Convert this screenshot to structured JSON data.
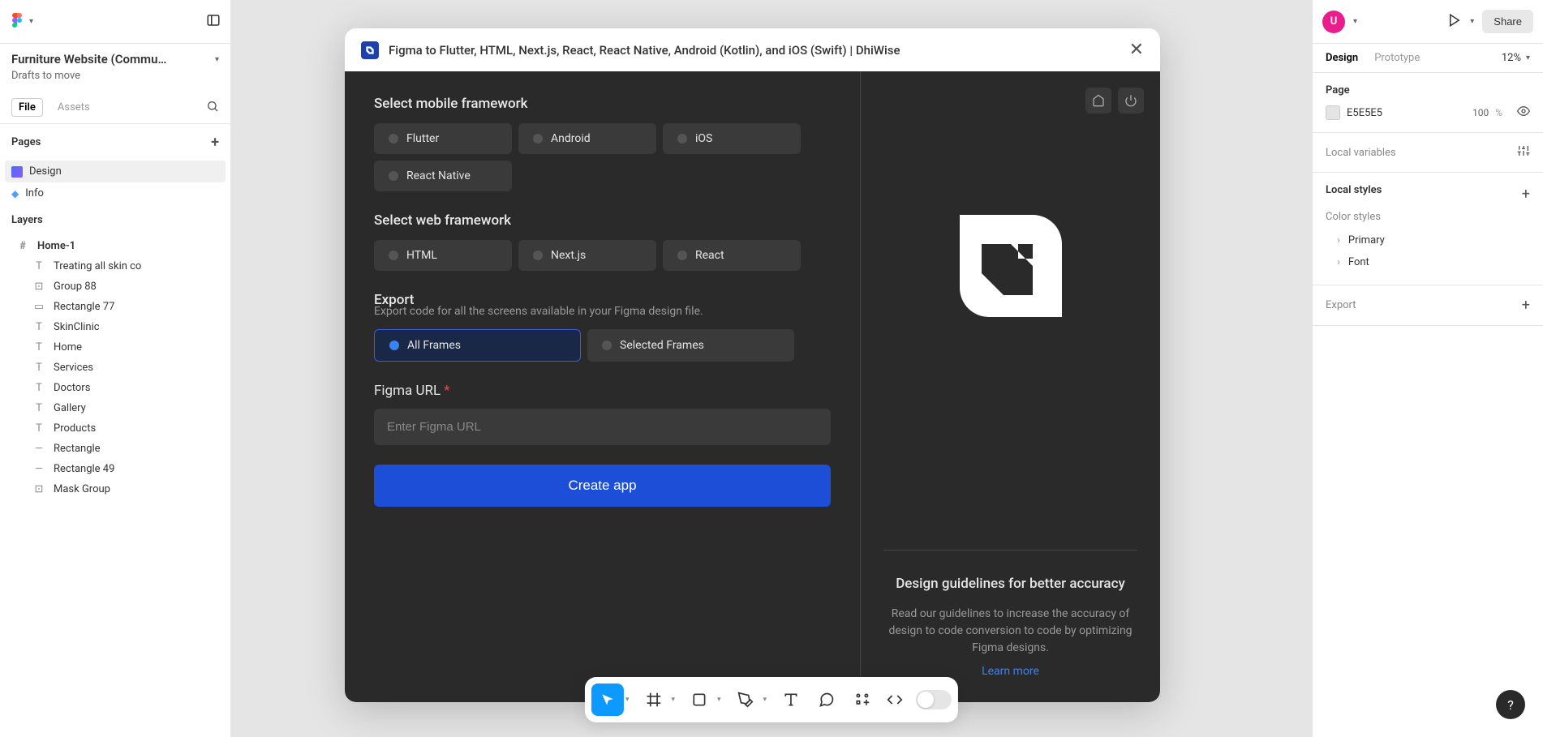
{
  "file": {
    "name": "Furniture Website (Commu…",
    "drafts": "Drafts to move"
  },
  "leftTabs": {
    "file": "File",
    "assets": "Assets"
  },
  "pages": {
    "header": "Pages",
    "items": [
      {
        "label": "Design",
        "active": true,
        "icon": "page"
      },
      {
        "label": "Info",
        "active": false,
        "icon": "info"
      }
    ]
  },
  "layers": {
    "header": "Layers",
    "frame": "Home-1",
    "items": [
      {
        "icon": "T",
        "label": "Treating all skin co"
      },
      {
        "icon": "⊡",
        "label": "Group 88"
      },
      {
        "icon": "▭",
        "label": "Rectangle 77"
      },
      {
        "icon": "T",
        "label": "SkinClinic"
      },
      {
        "icon": "T",
        "label": "Home"
      },
      {
        "icon": "T",
        "label": "Services"
      },
      {
        "icon": "T",
        "label": "Doctors"
      },
      {
        "icon": "T",
        "label": "Gallery"
      },
      {
        "icon": "T",
        "label": "Products"
      },
      {
        "icon": "—",
        "label": "Rectangle"
      },
      {
        "icon": "—",
        "label": "Rectangle 49"
      },
      {
        "icon": "⊡",
        "label": "Mask Group"
      }
    ]
  },
  "rightTop": {
    "avatar": "U",
    "share": "Share"
  },
  "rightTabs": {
    "design": "Design",
    "prototype": "Prototype",
    "zoom": "12%"
  },
  "pageSection": {
    "title": "Page",
    "color": "E5E5E5",
    "opacity": "100",
    "pct": "%"
  },
  "localVars": "Local variables",
  "localStyles": {
    "title": "Local styles",
    "colorStyles": "Color styles",
    "items": [
      "Primary",
      "Font"
    ]
  },
  "export": "Export",
  "modal": {
    "title": "Figma to Flutter, HTML, Next.js, React, React Native, Android (Kotlin), and iOS (Swift) | DhiWise",
    "mobileTitle": "Select mobile framework",
    "mobile": [
      "Flutter",
      "Android",
      "iOS",
      "React Native"
    ],
    "webTitle": "Select web framework",
    "web": [
      "HTML",
      "Next.js",
      "React"
    ],
    "exportTitle": "Export",
    "exportSub": "Export code for all the screens available in your Figma design file.",
    "exportOpts": [
      "All Frames",
      "Selected Frames"
    ],
    "urlLabel": "Figma URL",
    "urlPlaceholder": "Enter Figma URL",
    "createBtn": "Create app",
    "guidelinesTitle": "Design guidelines for better accuracy",
    "guidelinesBody": "Read our guidelines to increase the accuracy of design to code conversion to code by optimizing Figma designs.",
    "learnMore": "Learn more"
  }
}
